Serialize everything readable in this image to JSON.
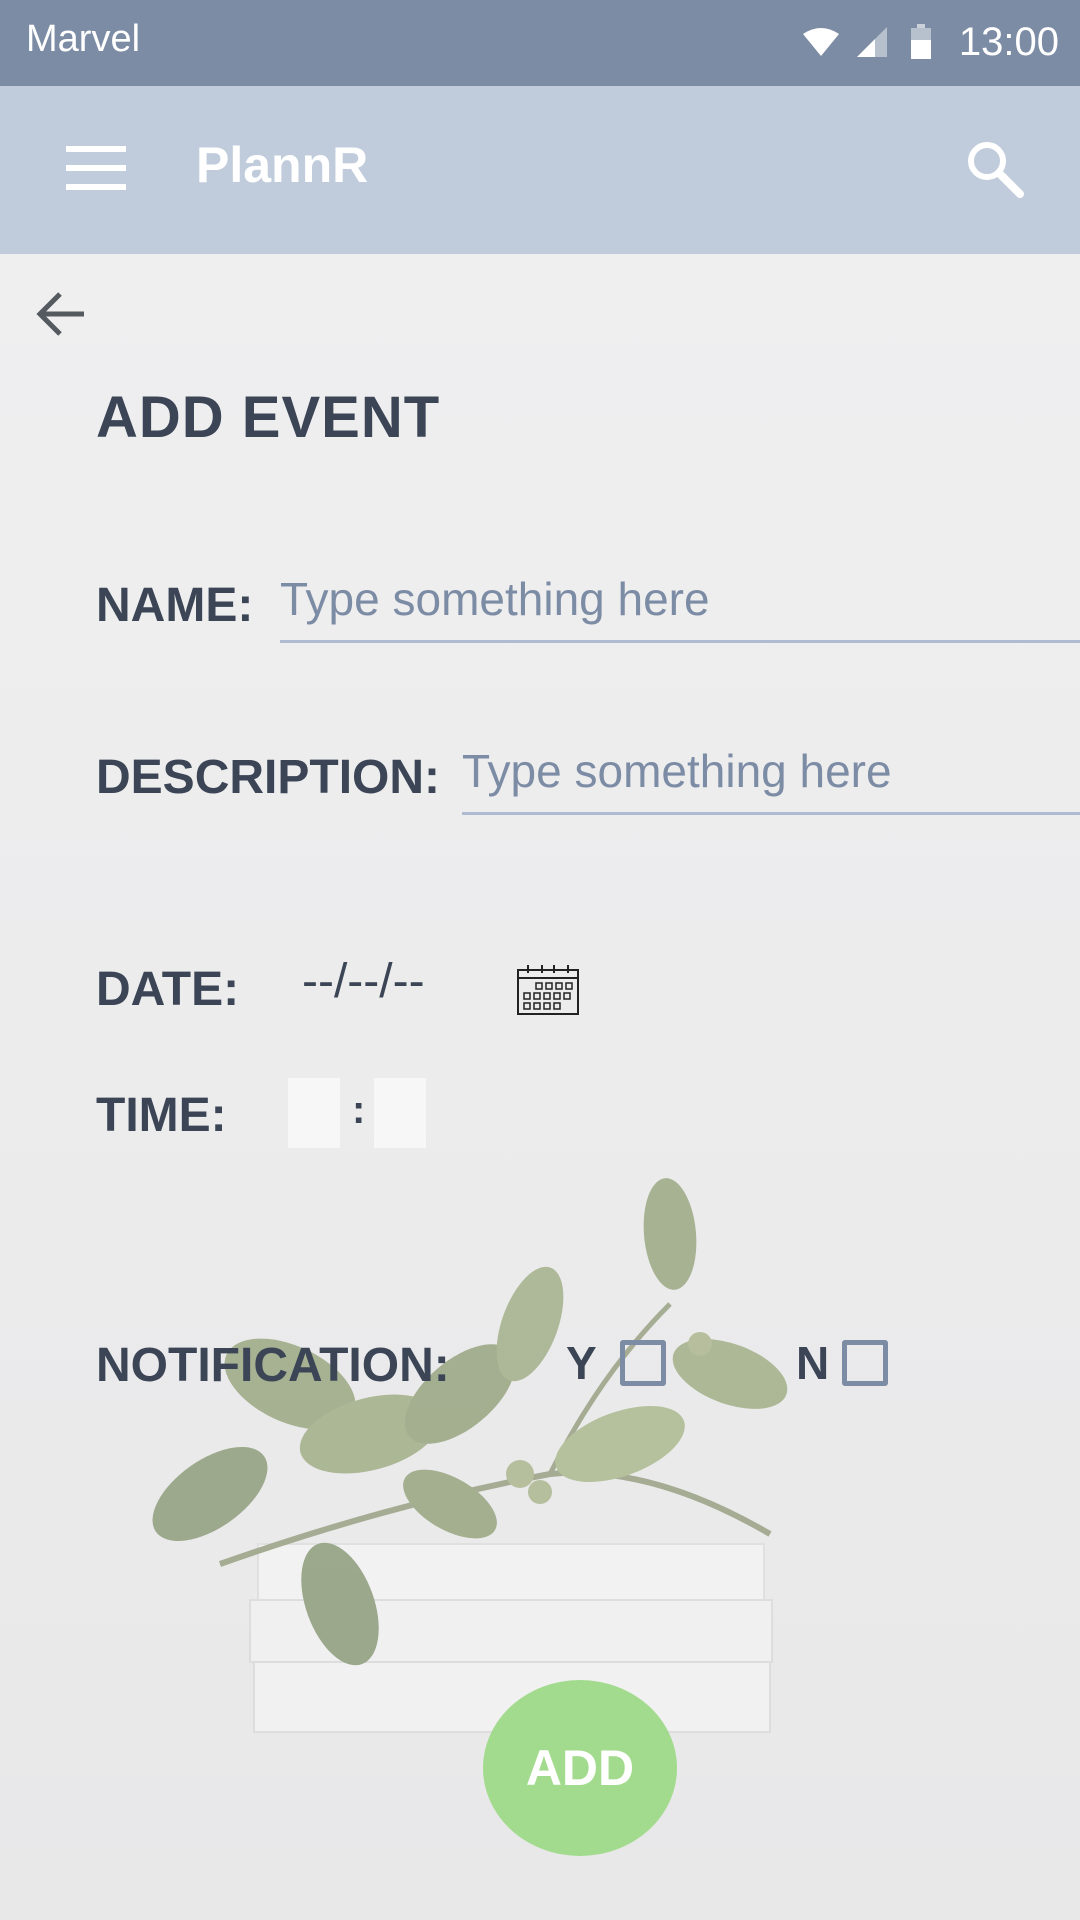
{
  "status_bar": {
    "carrier": "Marvel",
    "time": "13:00",
    "icons": [
      "wifi-icon",
      "signal-icon",
      "battery-icon"
    ]
  },
  "app_bar": {
    "title": "PlannR",
    "menu_icon": "menu-icon",
    "search_icon": "search-icon"
  },
  "form": {
    "title": "ADD EVENT",
    "name": {
      "label": "NAME:",
      "placeholder": "Type something here",
      "value": ""
    },
    "description": {
      "label": "DESCRIPTION:",
      "placeholder": "Type something here",
      "value": ""
    },
    "date": {
      "label": "DATE:",
      "value": "--/--/--",
      "icon": "calendar-icon"
    },
    "time": {
      "label": "TIME:",
      "separator": ":",
      "hours": "",
      "minutes": ""
    },
    "notification": {
      "label": "NOTIFICATION:",
      "yes_label": "Y",
      "no_label": "N",
      "yes_checked": false,
      "no_checked": false
    },
    "submit_label": "ADD"
  },
  "colors": {
    "status_bar": "#7d8ca5",
    "app_bar": "#c0ccdb",
    "label_text": "#3b4556",
    "placeholder": "#7d8ca5",
    "underline": "#aebbd0",
    "add_button": "#a3db8e"
  }
}
